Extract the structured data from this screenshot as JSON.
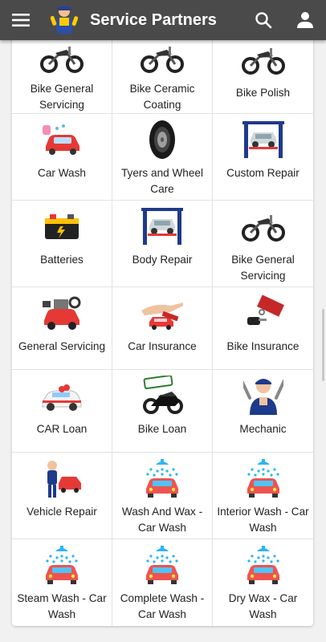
{
  "appbar": {
    "title": "Service Partners",
    "background": "#4a4a4a"
  },
  "services": [
    {
      "label": "Bike General Servicing",
      "icon": "motorbike-icon"
    },
    {
      "label": "Bike Ceramic Coating",
      "icon": "motorbike-icon"
    },
    {
      "label": "Bike Polish",
      "icon": "motorbike-icon"
    },
    {
      "label": "Car Wash",
      "icon": "car-wash-icon"
    },
    {
      "label": "Tyers and Wheel Care",
      "icon": "tyre-icon"
    },
    {
      "label": "Custom Repair",
      "icon": "car-lift-icon"
    },
    {
      "label": "Batteries",
      "icon": "battery-icon"
    },
    {
      "label": "Body Repair",
      "icon": "car-lift-icon"
    },
    {
      "label": "Bike General Servicing",
      "icon": "motorbike-icon"
    },
    {
      "label": "General Servicing",
      "icon": "car-engine-icon"
    },
    {
      "label": "Car Insurance",
      "icon": "hand-car-insurance-icon"
    },
    {
      "label": "Bike Insurance",
      "icon": "key-insurance-tag-icon"
    },
    {
      "label": "CAR Loan",
      "icon": "car-gift-icon"
    },
    {
      "label": "Bike Loan",
      "icon": "approved-bike-icon"
    },
    {
      "label": "Mechanic",
      "icon": "mechanic-icon"
    },
    {
      "label": "Vehicle Repair",
      "icon": "mechanic-car-icon"
    },
    {
      "label": "Wash And Wax - Car Wash",
      "icon": "car-wash-shower-icon"
    },
    {
      "label": "Interior Wash - Car Wash",
      "icon": "car-wash-shower-icon"
    },
    {
      "label": "Steam Wash - Car Wash",
      "icon": "car-wash-shower-icon"
    },
    {
      "label": "Complete Wash - Car Wash",
      "icon": "car-wash-shower-icon"
    },
    {
      "label": "Dry Wax - Car Wash",
      "icon": "car-wash-shower-icon"
    }
  ]
}
